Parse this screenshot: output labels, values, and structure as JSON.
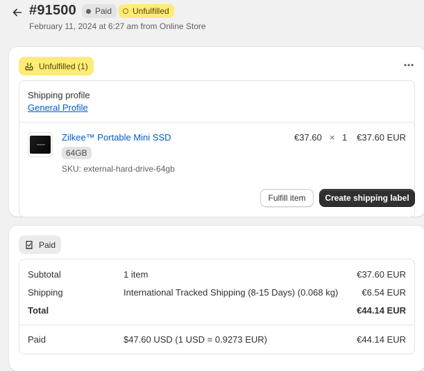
{
  "header": {
    "order_number": "#91500",
    "badge_paid": "Paid",
    "badge_unfulfilled": "Unfulfilled",
    "subtitle": "February 11, 2024 at 6:27 am from Online Store"
  },
  "fulfillment_card": {
    "status_label": "Unfulfilled (1)",
    "shipping_profile_label": "Shipping profile",
    "shipping_profile_link": "General Profile",
    "line_item": {
      "name": "Zilkee™ Portable Mini SSD",
      "variant": "64GB",
      "sku": "SKU: external-hard-drive-64gb",
      "unit_price": "€37.60",
      "times": "×",
      "quantity": "1",
      "total": "€37.60 EUR"
    },
    "buttons": {
      "fulfill": "Fulfill item",
      "create_label": "Create shipping label"
    }
  },
  "payment_card": {
    "status_label": "Paid",
    "rows": [
      {
        "label": "Subtotal",
        "detail": "1 item",
        "amount": "€37.60 EUR"
      },
      {
        "label": "Shipping",
        "detail": "International Tracked Shipping (8-15 Days) (0.068 kg)",
        "amount": "€6.54 EUR"
      },
      {
        "label": "Total",
        "detail": "",
        "amount": "€44.14 EUR"
      }
    ],
    "paid_row": {
      "label": "Paid",
      "detail": "$47.60 USD (1 USD = 0.9273 EUR)",
      "amount": "€44.14 EUR"
    }
  },
  "icons": {
    "back": "arrow-left-icon",
    "more": "more-horizontal-icon",
    "unfulfilled": "inbox-icon",
    "paid": "receipt-icon"
  },
  "colors": {
    "accent_link": "#005bd3",
    "unfulfilled_bg": "#ffeb78",
    "primary_button": "#303030"
  }
}
